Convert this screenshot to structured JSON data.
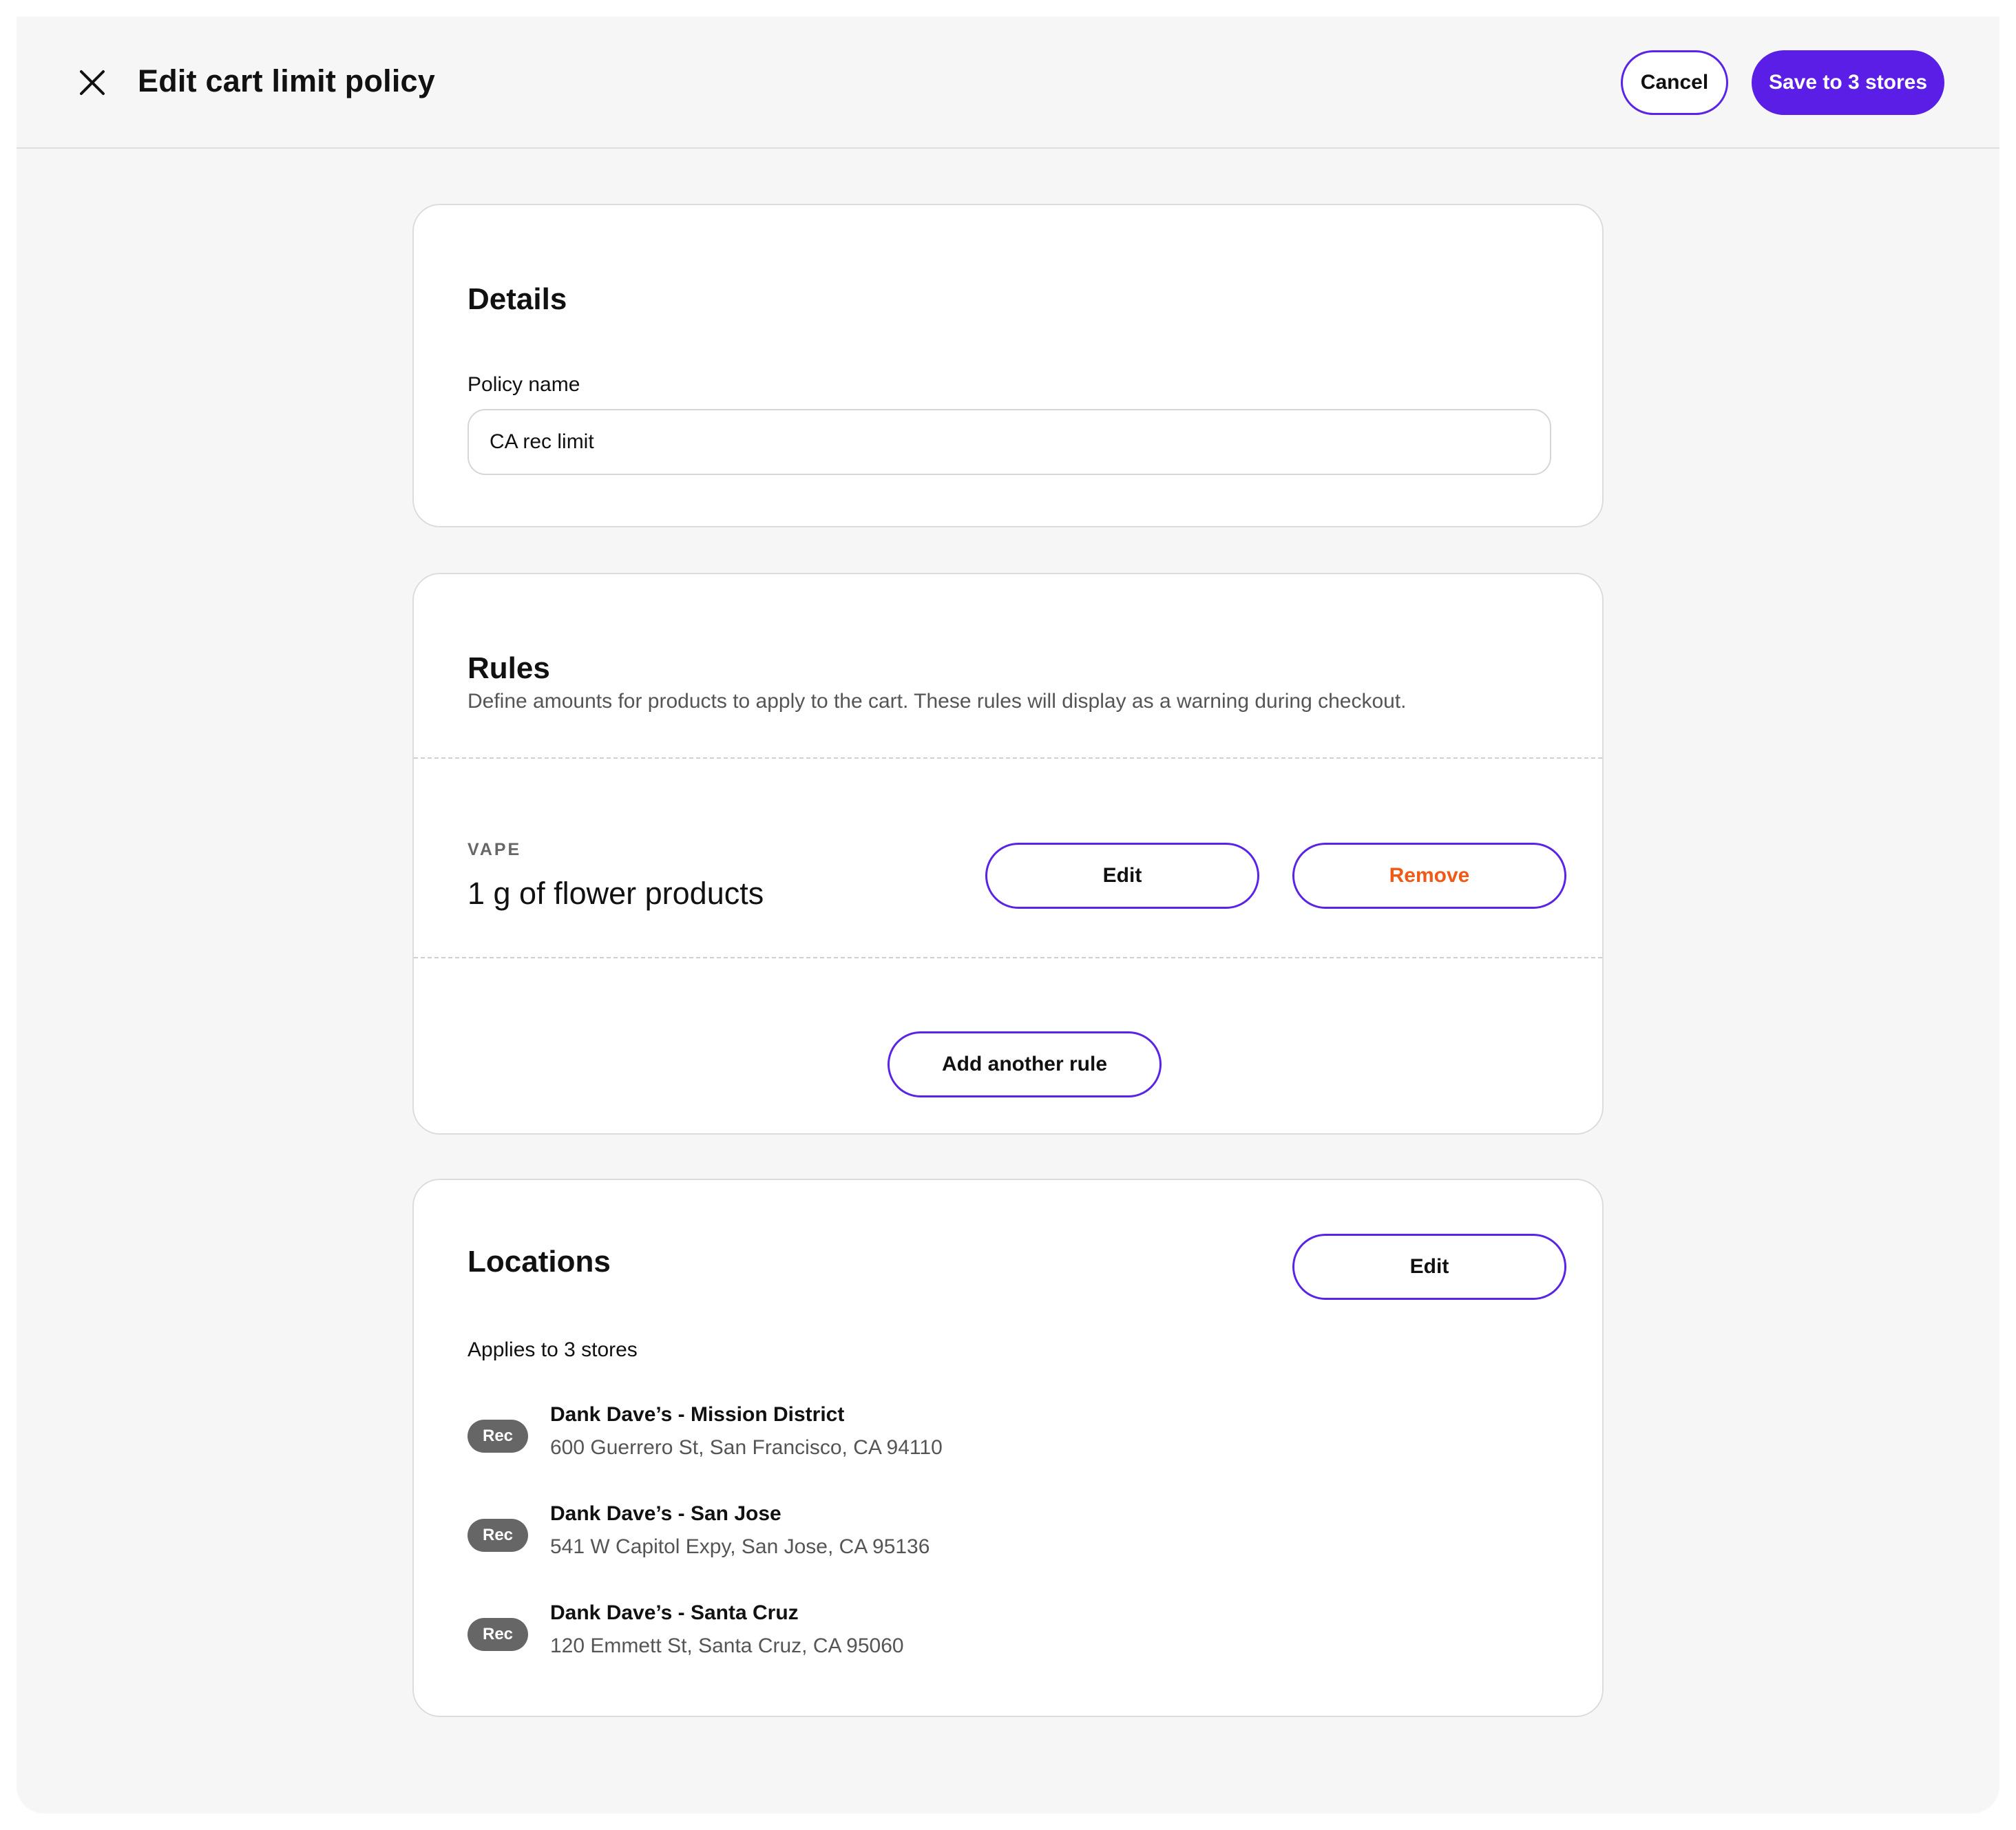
{
  "header": {
    "title": "Edit cart limit policy",
    "cancel_label": "Cancel",
    "save_label": "Save to 3 stores",
    "close_icon": "close-icon"
  },
  "details": {
    "title": "Details",
    "policy_name_label": "Policy name",
    "policy_name_value": "CA rec limit"
  },
  "rules": {
    "title": "Rules",
    "description": "Define amounts for products to apply to the cart. These rules will display as a warning during checkout.",
    "items": [
      {
        "category": "VAPE",
        "description": "1 g of flower products",
        "edit_label": "Edit",
        "remove_label": "Remove"
      }
    ],
    "add_label": "Add another rule"
  },
  "locations": {
    "title": "Locations",
    "edit_label": "Edit",
    "applies_text": "Applies to 3 stores",
    "stores": [
      {
        "badge": "Rec",
        "name": "Dank Dave’s - Mission District",
        "address": "600 Guerrero St, San Francisco, CA 94110"
      },
      {
        "badge": "Rec",
        "name": "Dank Dave’s - San Jose",
        "address": "541 W Capitol Expy, San Jose, CA 95136"
      },
      {
        "badge": "Rec",
        "name": "Dank Dave’s - Santa Cruz",
        "address": "120 Emmett St, Santa Cruz, CA 95060"
      }
    ]
  },
  "colors": {
    "accent": "#5a1ee6",
    "danger": "#ef5a17",
    "badge": "#666666",
    "background": "#f6f6f6"
  }
}
